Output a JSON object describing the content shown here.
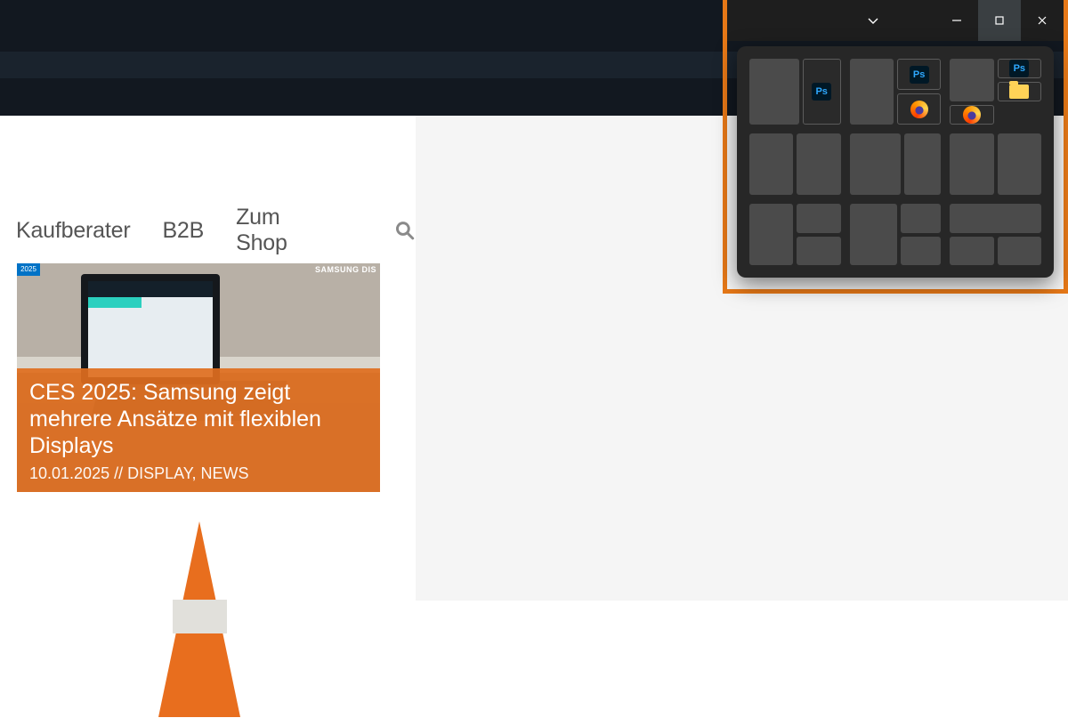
{
  "nav": {
    "items": [
      "Kaufberater",
      "B2B",
      "Zum Shop"
    ]
  },
  "article": {
    "corner_left": "2025",
    "corner_right": "SAMSUNG DIS",
    "title": "CES 2025: Samsung zeigt mehrere Ansätze mit flexiblen Displays",
    "date": "10.01.2025",
    "meta_sep": " // ",
    "categories": "DISPLAY, NEWS"
  },
  "snap": {
    "ps_label": "Ps"
  }
}
